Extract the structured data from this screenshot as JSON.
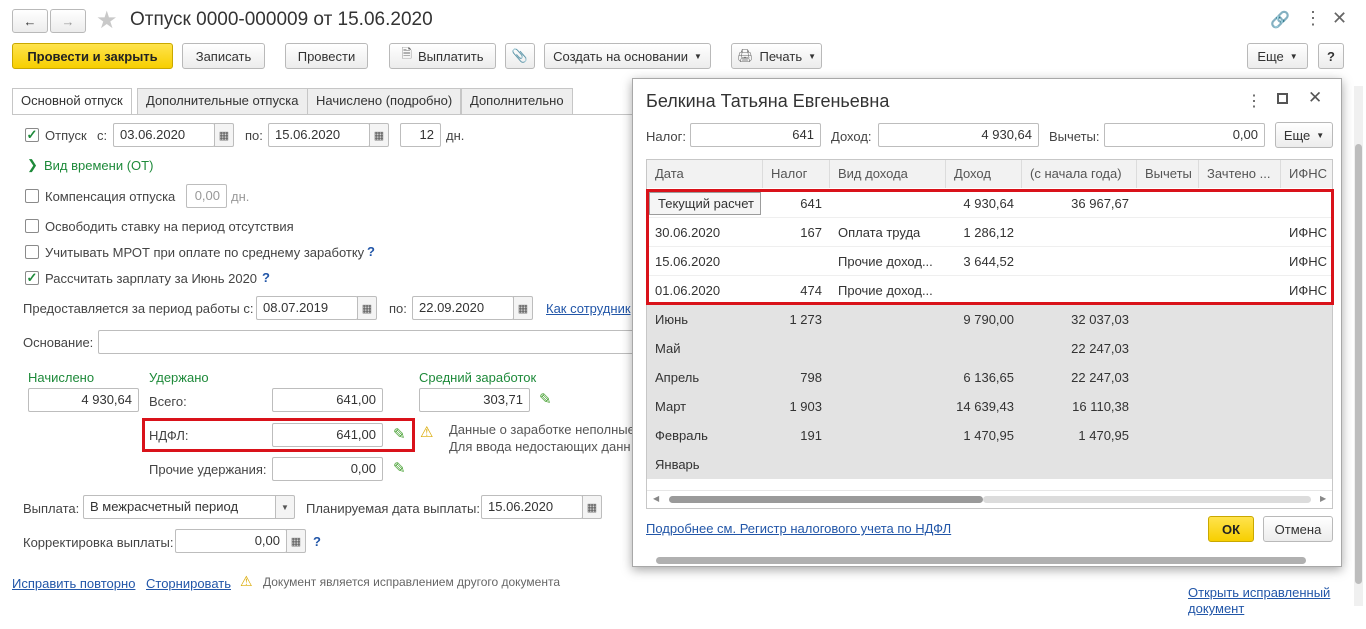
{
  "window": {
    "title": "Отпуск 0000-000009 от 15.06.2020"
  },
  "toolbar": {
    "post_close": "Провести и закрыть",
    "save": "Записать",
    "post": "Провести",
    "pay": "Выплатить",
    "create_based": "Создать на основании",
    "print": "Печать",
    "more": "Еще",
    "help": "?"
  },
  "tabs": [
    "Основной отпуск",
    "Дополнительные отпуска",
    "Начислено (подробно)",
    "Дополнительно"
  ],
  "form": {
    "vacation_label": "Отпуск",
    "from_label": "с:",
    "from_value": "03.06.2020",
    "to_label": "по:",
    "to_value": "15.06.2020",
    "days_value": "12",
    "days_label": "дн.",
    "time_type": "Вид времени (ОТ)",
    "compensation_label": "Компенсация отпуска",
    "compensation_value": "0,00",
    "compensation_days": "дн.",
    "release_rate": "Освободить ставку на период отсутствия",
    "consider_mrot": "Учитывать МРОТ при оплате по среднему заработку",
    "calc_salary": "Рассчитать зарплату за Июнь 2020",
    "period_label": "Предоставляется за период работы с:",
    "period_from": "08.07.2019",
    "period_to_label": "по:",
    "period_to": "22.09.2020",
    "how_employee": "Как сотрудник",
    "basis_label": "Основание:",
    "accrued_label": "Начислено",
    "accrued_value": "4 930,64",
    "withheld_label": "Удержано",
    "total_label": "Всего:",
    "total_value": "641,00",
    "ndfl_label": "НДФЛ:",
    "ndfl_value": "641,00",
    "other_label": "Прочие удержания:",
    "other_value": "0,00",
    "avg_label": "Средний заработок",
    "avg_value": "303,71",
    "warning_line1": "Данные о заработке неполные",
    "warning_line2": "Для ввода недостающих данн",
    "payment_label": "Выплата:",
    "payment_value": "В межрасчетный период",
    "planned_label": "Планируемая дата выплаты:",
    "planned_value": "15.06.2020",
    "correction_label": "Корректировка выплаты:",
    "correction_value": "0,00"
  },
  "footer": {
    "fix_again": "Исправить повторно",
    "reverse": "Сторнировать",
    "note": "Документ является исправлением другого документа",
    "open_fixed_1": "Открыть исправленный",
    "open_fixed_2": "документ"
  },
  "dialog": {
    "title": "Белкина Татьяна Евгеньевна",
    "tax_label": "Налог:",
    "tax_value": "641",
    "income_label": "Доход:",
    "income_value": "4 930,64",
    "deductions_label": "Вычеты:",
    "deductions_value": "0,00",
    "more": "Еще",
    "columns": [
      "Дата",
      "Налог",
      "Вид дохода",
      "Доход",
      "(с начала года)",
      "Вычеты",
      "Зачтено ...",
      "ИФНС"
    ],
    "rows": [
      [
        "Текущий расчет",
        "641",
        "",
        "4 930,64",
        "36 967,67",
        "",
        "",
        ""
      ],
      [
        "30.06.2020",
        "167",
        "Оплата труда",
        "1 286,12",
        "",
        "",
        "",
        "ИФНС"
      ],
      [
        "15.06.2020",
        "",
        "Прочие доход...",
        "3 644,52",
        "",
        "",
        "",
        "ИФНС"
      ],
      [
        "01.06.2020",
        "474",
        "Прочие доход...",
        "",
        "",
        "",
        "",
        "ИФНС"
      ],
      [
        "Июнь",
        "1 273",
        "",
        "9 790,00",
        "32 037,03",
        "",
        "",
        ""
      ],
      [
        "Май",
        "",
        "",
        "",
        "22 247,03",
        "",
        "",
        ""
      ],
      [
        "Апрель",
        "798",
        "",
        "6 136,65",
        "22 247,03",
        "",
        "",
        ""
      ],
      [
        "Март",
        "1 903",
        "",
        "14 639,43",
        "16 110,38",
        "",
        "",
        ""
      ],
      [
        "Февраль",
        "191",
        "",
        "1 470,95",
        "1 470,95",
        "",
        "",
        ""
      ],
      [
        "Январь",
        "",
        "",
        "",
        "",
        "",
        "",
        ""
      ]
    ],
    "details_link": "Подробнее см. Регистр налогового учета по НДФЛ",
    "ok": "ОК",
    "cancel": "Отмена"
  }
}
